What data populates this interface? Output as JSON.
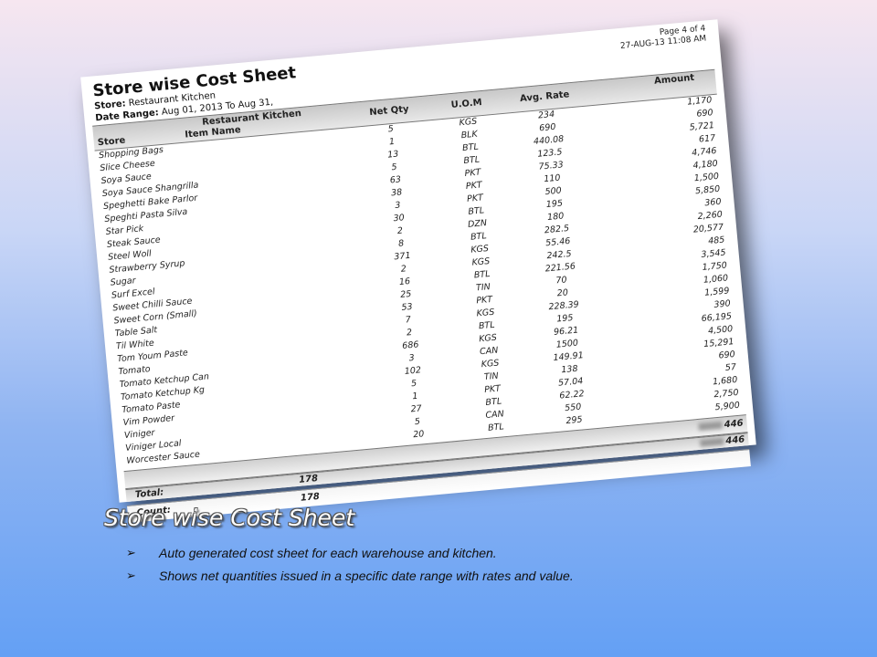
{
  "report": {
    "page": "Page 4 of 4",
    "datetime": "27-AUG-13 11:08 AM",
    "title": "Store wise Cost Sheet",
    "store_label": "Store:",
    "store_value": "Restaurant Kitchen",
    "date_label": "Date Range:",
    "date_value": "Aug 01, 2013 To Aug 31,",
    "group_header": "Restaurant Kitchen",
    "columns": {
      "store": "Store",
      "item": "Item Name",
      "qty": "Net Qty",
      "uom": "U.O.M",
      "rate": "Avg. Rate",
      "amount": "Amount"
    },
    "rows": [
      {
        "name": "Shopping Bags",
        "qty": "5",
        "uom": "KGS",
        "rate": "234",
        "amount": "1,170"
      },
      {
        "name": "Slice Cheese",
        "qty": "1",
        "uom": "BLK",
        "rate": "690",
        "amount": "690"
      },
      {
        "name": "Soya Sauce",
        "qty": "13",
        "uom": "BTL",
        "rate": "440.08",
        "amount": "5,721"
      },
      {
        "name": "Soya Sauce Shangrilla",
        "qty": "5",
        "uom": "BTL",
        "rate": "123.5",
        "amount": "617"
      },
      {
        "name": "Speghetti Bake Parlor",
        "qty": "63",
        "uom": "PKT",
        "rate": "75.33",
        "amount": "4,746"
      },
      {
        "name": "Speghti Pasta Silva",
        "qty": "38",
        "uom": "PKT",
        "rate": "110",
        "amount": "4,180"
      },
      {
        "name": "Star Pick",
        "qty": "3",
        "uom": "PKT",
        "rate": "500",
        "amount": "1,500"
      },
      {
        "name": "Steak Sauce",
        "qty": "30",
        "uom": "BTL",
        "rate": "195",
        "amount": "5,850"
      },
      {
        "name": "Steel Woll",
        "qty": "2",
        "uom": "DZN",
        "rate": "180",
        "amount": "360"
      },
      {
        "name": "Strawberry Syrup",
        "qty": "8",
        "uom": "BTL",
        "rate": "282.5",
        "amount": "2,260"
      },
      {
        "name": "Sugar",
        "qty": "371",
        "uom": "KGS",
        "rate": "55.46",
        "amount": "20,577"
      },
      {
        "name": "Surf Excel",
        "qty": "2",
        "uom": "KGS",
        "rate": "242.5",
        "amount": "485"
      },
      {
        "name": "Sweet Chilli Sauce",
        "qty": "16",
        "uom": "BTL",
        "rate": "221.56",
        "amount": "3,545"
      },
      {
        "name": "Sweet Corn (Small)",
        "qty": "25",
        "uom": "TIN",
        "rate": "70",
        "amount": "1,750"
      },
      {
        "name": "Table Salt",
        "qty": "53",
        "uom": "PKT",
        "rate": "20",
        "amount": "1,060"
      },
      {
        "name": "Til White",
        "qty": "7",
        "uom": "KGS",
        "rate": "228.39",
        "amount": "1,599"
      },
      {
        "name": "Tom Youm Paste",
        "qty": "2",
        "uom": "BTL",
        "rate": "195",
        "amount": "390"
      },
      {
        "name": "Tomato",
        "qty": "686",
        "uom": "KGS",
        "rate": "96.21",
        "amount": "66,195"
      },
      {
        "name": "Tomato Ketchup Can",
        "qty": "3",
        "uom": "CAN",
        "rate": "1500",
        "amount": "4,500"
      },
      {
        "name": "Tomato Ketchup Kg",
        "qty": "102",
        "uom": "KGS",
        "rate": "149.91",
        "amount": "15,291"
      },
      {
        "name": "Tomato Paste",
        "qty": "5",
        "uom": "TIN",
        "rate": "138",
        "amount": "690"
      },
      {
        "name": "Vim Powder",
        "qty": "1",
        "uom": "PKT",
        "rate": "57.04",
        "amount": "57"
      },
      {
        "name": "Viniger",
        "qty": "27",
        "uom": "BTL",
        "rate": "62.22",
        "amount": "1,680"
      },
      {
        "name": "Viniger Local",
        "qty": "5",
        "uom": "CAN",
        "rate": "550",
        "amount": "2,750"
      },
      {
        "name": "Worcester Sauce",
        "qty": "20",
        "uom": "BTL",
        "rate": "295",
        "amount": "5,900"
      }
    ],
    "group_total": "446",
    "total_label": "Total:",
    "total_qty": "178",
    "total_amount": "446",
    "count_label": "Count:",
    "count_value": "178"
  },
  "caption": "Store wise Cost Sheet",
  "bullets": [
    "Auto generated cost sheet for each warehouse and kitchen.",
    "Shows net quantities issued in a specific date range with rates and value."
  ],
  "bullet_glyph": "➢"
}
